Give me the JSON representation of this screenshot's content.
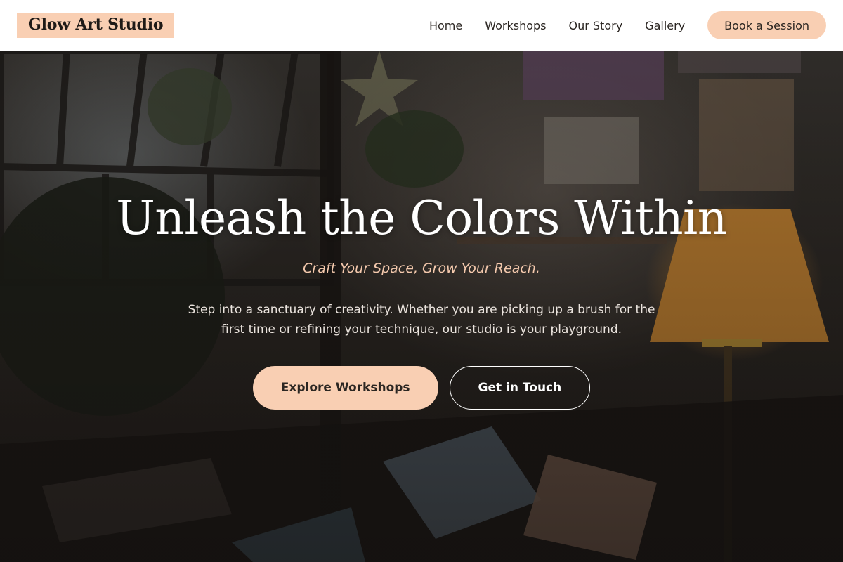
{
  "header": {
    "logo": "Glow Art Studio",
    "nav": [
      {
        "label": "Home"
      },
      {
        "label": "Workshops"
      },
      {
        "label": "Our Story"
      },
      {
        "label": "Gallery"
      }
    ],
    "cta_label": "Book a Session"
  },
  "hero": {
    "title": "Unleash the Colors Within",
    "tagline": "Craft Your Space, Grow Your Reach.",
    "description": "Step into a sanctuary of creativity. Whether you are picking up a brush for the first time or refining your technique, our studio is your playground.",
    "primary_button": "Explore Workshops",
    "secondary_button": "Get in Touch"
  },
  "colors": {
    "accent": "#f9cfb3",
    "header_bg": "#ffffff",
    "tagline": "#f4c9ad",
    "hero_text": "#ffffff"
  }
}
